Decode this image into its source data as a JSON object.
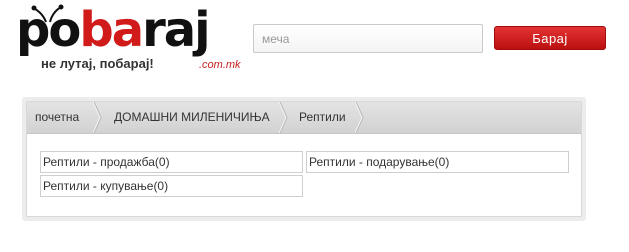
{
  "header": {
    "logo": {
      "text_part1": "po",
      "text_part2": "ba",
      "text_part3": "raj",
      "slogan": "не лутај, побарај!",
      "domain": ".com.mk"
    },
    "search": {
      "placeholder": "меча",
      "button_label": "Барај"
    }
  },
  "breadcrumb": [
    "почетна",
    "ДОМАШНИ МИЛЕНИЧИЊА",
    "Рептили"
  ],
  "categories": [
    "Рептили - продажба(0)",
    "Рептили - подарување(0)",
    "Рептили - купување(0)"
  ],
  "colors": {
    "brand_red": "#d11b1b",
    "button_red": "#cc1a1a",
    "breadcrumb_bg": "#d9d9d9"
  },
  "icons": [
    "ant-logo-icon",
    "chevron-right-icon"
  ]
}
